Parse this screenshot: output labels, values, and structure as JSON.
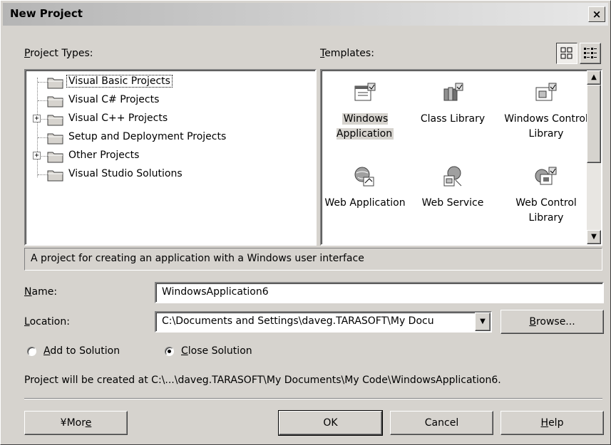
{
  "window": {
    "title": "New Project",
    "close_glyph": "×"
  },
  "project_types": {
    "label_u": "P",
    "label_rest": "roject Types:",
    "items": [
      {
        "label": "Visual Basic Projects",
        "selected": true,
        "expandable": false
      },
      {
        "label": "Visual C# Projects",
        "selected": false,
        "expandable": false
      },
      {
        "label": "Visual C++ Projects",
        "selected": false,
        "expandable": true
      },
      {
        "label": "Setup and Deployment Projects",
        "selected": false,
        "expandable": false
      },
      {
        "label": "Other Projects",
        "selected": false,
        "expandable": true
      },
      {
        "label": "Visual Studio Solutions",
        "selected": false,
        "expandable": false
      }
    ],
    "expander_glyph": "+"
  },
  "templates": {
    "label_u": "T",
    "label_rest": "emplates:",
    "items": [
      {
        "label": "Windows Application",
        "icon": "windows-application-icon",
        "selected": true
      },
      {
        "label": "Class Library",
        "icon": "class-library-icon",
        "selected": false
      },
      {
        "label": "Windows Control Library",
        "icon": "windows-control-library-icon",
        "selected": false
      },
      {
        "label": "Web Application",
        "icon": "web-application-icon",
        "selected": false
      },
      {
        "label": "Web Service",
        "icon": "web-service-icon",
        "selected": false
      },
      {
        "label": "Web Control Library",
        "icon": "web-control-library-icon",
        "selected": false
      }
    ],
    "scroll_up_glyph": "▲",
    "scroll_down_glyph": "▼"
  },
  "description": "A project for creating an application with a Windows user interface",
  "name_field": {
    "label_u": "N",
    "label_rest": "ame:",
    "value": "WindowsApplication6"
  },
  "location_field": {
    "label_u": "L",
    "label_rest": "ocation:",
    "value": "C:\\Documents and Settings\\daveg.TARASOFT\\My Docu",
    "dropdown_glyph": "▼"
  },
  "browse_button": {
    "label_u": "B",
    "label_rest": "rowse..."
  },
  "radios": {
    "add_to_solution": {
      "label_u": "A",
      "label_rest": "dd to Solution",
      "checked": false
    },
    "close_solution": {
      "label_u": "C",
      "label_rest": "lose Solution",
      "checked": true
    }
  },
  "project_path": "Project will be created at C:\\...\\daveg.TARASOFT\\My Documents\\My Code\\WindowsApplication6.",
  "buttons": {
    "more": {
      "glyph": "¥",
      "label_pre": "Mor",
      "label_u": "e"
    },
    "ok": "OK",
    "cancel": "Cancel",
    "help": {
      "label_u": "H",
      "label_rest": "elp"
    }
  },
  "colors": {
    "dialog_bg": "#d6d3ce",
    "field_bg": "#ffffff",
    "shadow": "#808080"
  }
}
